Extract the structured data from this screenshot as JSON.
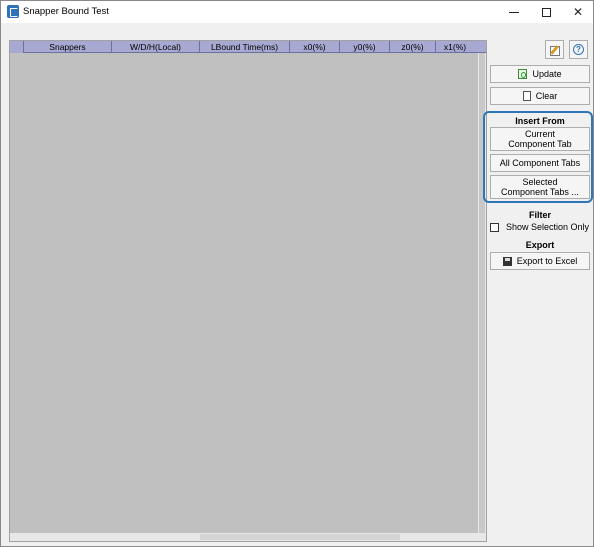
{
  "window": {
    "title": "Snapper Bound Test",
    "controls": [
      "minimize",
      "maximize",
      "close"
    ]
  },
  "grid": {
    "columns": [
      "Snappers",
      "W/D/H(Local)",
      "LBound Time(ms)",
      "x0(%)",
      "y0(%)",
      "z0(%)",
      "x1(%)"
    ],
    "rows": []
  },
  "panel": {
    "update_label": "Update",
    "clear_label": "Clear",
    "insert_from": {
      "title": "Insert From",
      "current_line1": "Current",
      "current_line2": "Component Tab",
      "all_label": "All Component Tabs",
      "selected_line1": "Selected",
      "selected_line2": "Component Tabs ..."
    },
    "filter": {
      "title": "Filter",
      "show_selection_label": "Show Selection Only",
      "show_selection_checked": false
    },
    "export": {
      "title": "Export",
      "excel_label": "Export to Excel"
    },
    "help_glyph": "?"
  },
  "colors": {
    "header_bg": "#a7a9d2",
    "grid_bg": "#c0c0c0",
    "group_border": "#2e75b6"
  }
}
